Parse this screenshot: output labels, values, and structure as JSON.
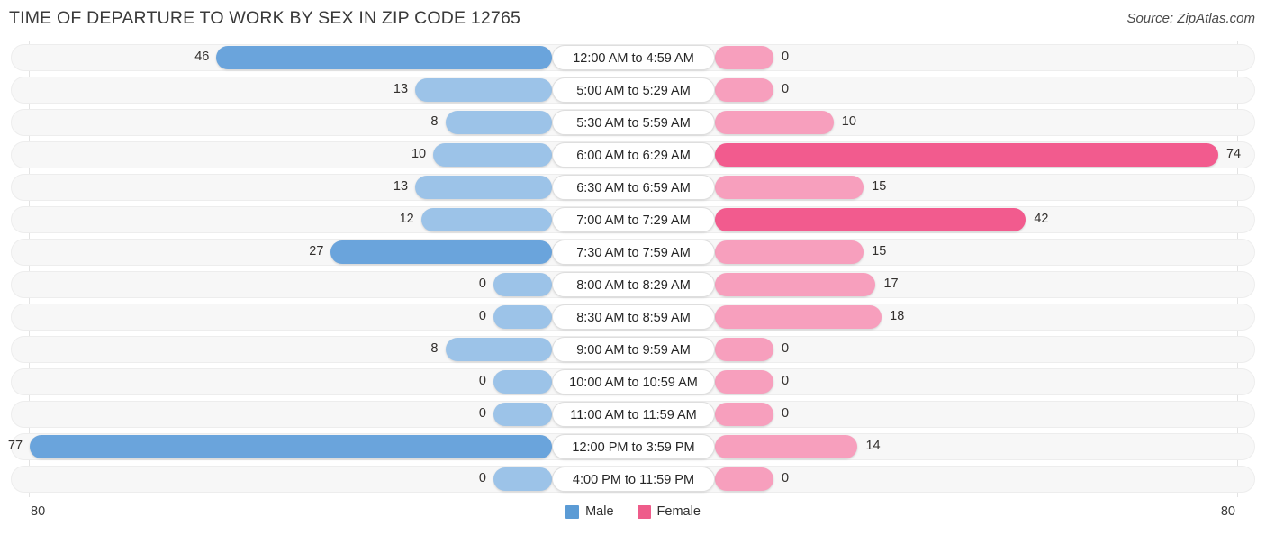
{
  "header": {
    "title": "TIME OF DEPARTURE TO WORK BY SEX IN ZIP CODE 12765",
    "source": "Source: ZipAtlas.com"
  },
  "axis": {
    "left_end": "80",
    "right_end": "80",
    "max": 80
  },
  "legend": {
    "items": [
      {
        "label": "Male",
        "color": "#5b9bd5"
      },
      {
        "label": "Female",
        "color": "#ee5c8a"
      }
    ]
  },
  "colors": {
    "male_strong": "#6aa4dc",
    "male_light": "#9cc3e8",
    "female_strong": "#f25b8e",
    "female_light": "#f79fbd",
    "track": "#f7f7f7",
    "track_border": "#ededed",
    "gridline": "#e3e3e3"
  },
  "chart_data": {
    "type": "bar",
    "orientation": "horizontal-diverging",
    "title": "TIME OF DEPARTURE TO WORK BY SEX IN ZIP CODE 12765",
    "xlabel": "",
    "ylabel": "",
    "xlim": [
      80,
      80
    ],
    "grid": true,
    "legend_position": "bottom-center",
    "categories": [
      "12:00 AM to 4:59 AM",
      "5:00 AM to 5:29 AM",
      "5:30 AM to 5:59 AM",
      "6:00 AM to 6:29 AM",
      "6:30 AM to 6:59 AM",
      "7:00 AM to 7:29 AM",
      "7:30 AM to 7:59 AM",
      "8:00 AM to 8:29 AM",
      "8:30 AM to 8:59 AM",
      "9:00 AM to 9:59 AM",
      "10:00 AM to 10:59 AM",
      "11:00 AM to 11:59 AM",
      "12:00 PM to 3:59 PM",
      "4:00 PM to 11:59 PM"
    ],
    "series": [
      {
        "name": "Male",
        "direction": "left",
        "color": "#5b9bd5",
        "values": [
          46,
          13,
          8,
          10,
          13,
          12,
          27,
          0,
          0,
          8,
          0,
          0,
          77,
          0
        ]
      },
      {
        "name": "Female",
        "direction": "right",
        "color": "#ee5c8a",
        "values": [
          0,
          0,
          10,
          74,
          15,
          42,
          15,
          17,
          18,
          0,
          0,
          0,
          14,
          0
        ]
      }
    ]
  }
}
